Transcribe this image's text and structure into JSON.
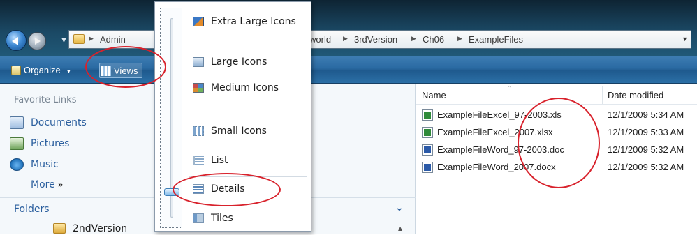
{
  "address_bar": {
    "crumbs": [
      "Admin",
      "world",
      "3rdVersion",
      "Ch06",
      "ExampleFiles"
    ]
  },
  "command_bar": {
    "organize_label": "Organize",
    "views_label": "Views"
  },
  "views_menu": {
    "items": [
      {
        "label": "Extra Large Icons",
        "icon": "extra-large-icons-icon"
      },
      {
        "label": "Large Icons",
        "icon": "large-icons-icon"
      },
      {
        "label": "Medium Icons",
        "icon": "medium-icons-icon"
      },
      {
        "label": "Small Icons",
        "icon": "small-icons-icon"
      },
      {
        "label": "List",
        "icon": "list-icon"
      },
      {
        "label": "Details",
        "icon": "details-icon"
      },
      {
        "label": "Tiles",
        "icon": "tiles-icon"
      }
    ],
    "selected": "Details"
  },
  "nav_pane": {
    "favorites_title": "Favorite Links",
    "favorites": [
      {
        "label": "Documents",
        "icon": "documents-icon"
      },
      {
        "label": "Pictures",
        "icon": "pictures-icon"
      },
      {
        "label": "Music",
        "icon": "music-icon"
      }
    ],
    "more_label": "More",
    "more_arrow": "»",
    "folders_label": "Folders",
    "tree": [
      "2ndVersion"
    ]
  },
  "file_list": {
    "columns": {
      "name": "Name",
      "date": "Date modified"
    },
    "rows": [
      {
        "name": "ExampleFileExcel_97-2003.xls",
        "date": "12/1/2009 5:34 AM",
        "type": "excel"
      },
      {
        "name": "ExampleFileExcel_2007.xlsx",
        "date": "12/1/2009 5:33 AM",
        "type": "excel"
      },
      {
        "name": "ExampleFileWord_97-2003.doc",
        "date": "12/1/2009 5:32 AM",
        "type": "word"
      },
      {
        "name": "ExampleFileWord_2007.docx",
        "date": "12/1/2009 5:32 AM",
        "type": "word"
      }
    ]
  },
  "colors": {
    "annotation": "#d8222c",
    "command_bar": "#2a6aa2",
    "link": "#2b5f9e"
  }
}
